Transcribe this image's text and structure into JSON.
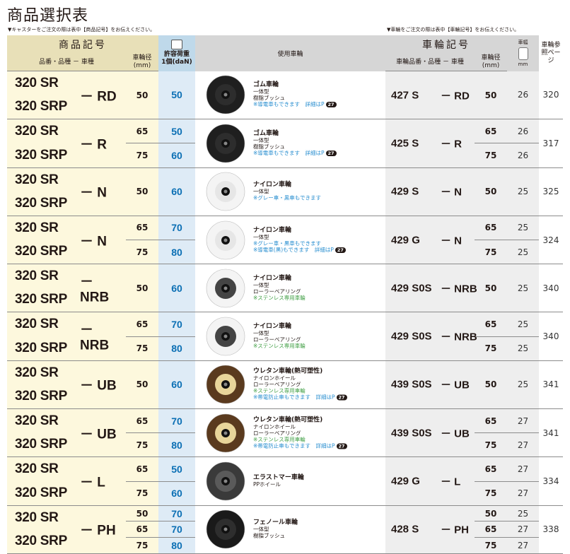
{
  "title": "商品選択表",
  "note_left": "▼キャスターをご注文の際は表中【商品記号】をお伝えください。",
  "note_right": "▼車輪をご注文の際は表中【車輪記号】をお伝えください。",
  "header": {
    "product_code": "商品記号",
    "product_sub": "品番・品種 － 車種",
    "wheel_dia": "車輪径",
    "wheel_dia_unit": "(mm)",
    "load": "許容荷重",
    "load_unit": "1個(daN)",
    "used_wheel": "使用車輪",
    "wheel_code": "車輪記号",
    "wheel_sub": "車輪品番・品種 － 車種",
    "wheel_dia2": "車輪径",
    "wheel_dia2_unit": "(mm)",
    "wheel_width": "車幅",
    "wheel_width_unit": "mm",
    "ref": "車輪参照ページ"
  },
  "rows": [
    {
      "name1": "320 SR",
      "name2": "320 SRP",
      "suffix": "－ RD",
      "dia": [
        "50"
      ],
      "load": [
        "50"
      ],
      "wtitle": "ゴム車輪",
      "wl": [
        [
          "一体型",
          ""
        ],
        [
          "樹脂ブッシュ",
          ""
        ],
        [
          "※導電車もできます　詳細はP",
          "bl"
        ]
      ],
      "badge": "27",
      "wheel_color": "#1f1f1f",
      "hub": "#2d2d2d",
      "wname": "427 S",
      "wsuf": "－ RD",
      "wdia": [
        "50"
      ],
      "wwidth": [
        "26"
      ],
      "ref": "320"
    },
    {
      "name1": "320 SR",
      "name2": "320 SRP",
      "suffix": "－ R",
      "dia": [
        "65",
        "75"
      ],
      "load": [
        "50",
        "60"
      ],
      "wtitle": "ゴム車輪",
      "wl": [
        [
          "一体型",
          ""
        ],
        [
          "樹脂ブッシュ",
          ""
        ],
        [
          "※導電車もできます　詳細はP",
          "bl"
        ]
      ],
      "badge": "27",
      "wheel_color": "#1f1f1f",
      "hub": "#2d2d2d",
      "wname": "425 S",
      "wsuf": "－ R",
      "wdia": [
        "65",
        "75"
      ],
      "wwidth": [
        "26",
        "26"
      ],
      "ref": "317"
    },
    {
      "name1": "320 SR",
      "name2": "320 SRP",
      "suffix": "－ N",
      "dia": [
        "50"
      ],
      "load": [
        "60"
      ],
      "wtitle": "ナイロン車輪",
      "wl": [
        [
          "一体型",
          ""
        ],
        [
          "※グレー車・黒車もできます",
          "bl"
        ]
      ],
      "badge": "",
      "wheel_color": "#f4f4f4",
      "hub": "#e6e6e6",
      "wname": "429 S",
      "wsuf": "－ N",
      "wdia": [
        "50"
      ],
      "wwidth": [
        "25"
      ],
      "ref": "325"
    },
    {
      "name1": "320 SR",
      "name2": "320 SRP",
      "suffix": "－ N",
      "dia": [
        "65",
        "75"
      ],
      "load": [
        "70",
        "80"
      ],
      "wtitle": "ナイロン車輪",
      "wl": [
        [
          "一体型",
          ""
        ],
        [
          "※グレー車・黒車もできます",
          "bl"
        ],
        [
          "※導電車(黒)もできます　詳細はP",
          "bl"
        ]
      ],
      "badge": "27",
      "wheel_color": "#f4f4f4",
      "hub": "#e6e6e6",
      "wname": "429 G",
      "wsuf": "－ N",
      "wdia": [
        "65",
        "75"
      ],
      "wwidth": [
        "25",
        "25"
      ],
      "ref": "324"
    },
    {
      "name1": "320 SR",
      "name2": "320 SRP",
      "suffix": "－ NRB",
      "dia": [
        "50"
      ],
      "load": [
        "60"
      ],
      "wtitle": "ナイロン車輪",
      "wl": [
        [
          "一体型",
          ""
        ],
        [
          "ローラーベアリング",
          ""
        ],
        [
          "※ステンレス専用車輪",
          "gr"
        ]
      ],
      "badge": "",
      "wheel_color": "#f4f4f4",
      "hub": "#444444",
      "wname": "429 S0S",
      "wsuf": "－ NRB",
      "wdia": [
        "50"
      ],
      "wwidth": [
        "25"
      ],
      "ref": "340"
    },
    {
      "name1": "320 SR",
      "name2": "320 SRP",
      "suffix": "－ NRB",
      "dia": [
        "65",
        "75"
      ],
      "load": [
        "70",
        "80"
      ],
      "wtitle": "ナイロン車輪",
      "wl": [
        [
          "一体型",
          ""
        ],
        [
          "ローラーベアリング",
          ""
        ],
        [
          "※ステンレス専用車輪",
          "gr"
        ]
      ],
      "badge": "",
      "wheel_color": "#f4f4f4",
      "hub": "#444444",
      "wname": "429 S0S",
      "wsuf": "－ NRB",
      "wdia": [
        "65",
        "75"
      ],
      "wwidth": [
        "25",
        "25"
      ],
      "ref": "340"
    },
    {
      "name1": "320 SR",
      "name2": "320 SRP",
      "suffix": "－ UB",
      "dia": [
        "50"
      ],
      "load": [
        "60"
      ],
      "wtitle": "ウレタン車輪(熱可塑性)",
      "wl": [
        [
          "ナイロンホイール",
          ""
        ],
        [
          "ローラーベアリング",
          ""
        ],
        [
          "※ステンレス専用車輪",
          "gr"
        ],
        [
          "※帯電防止車もできます　詳細はP",
          "bl"
        ]
      ],
      "badge": "27",
      "wheel_color": "#5a3a1e",
      "hub": "#e8d59a",
      "wname": "439 S0S",
      "wsuf": "－ UB",
      "wdia": [
        "50"
      ],
      "wwidth": [
        "25"
      ],
      "ref": "341"
    },
    {
      "name1": "320 SR",
      "name2": "320 SRP",
      "suffix": "－ UB",
      "dia": [
        "65",
        "75"
      ],
      "load": [
        "70",
        "80"
      ],
      "wtitle": "ウレタン車輪(熱可塑性)",
      "wl": [
        [
          "ナイロンホイール",
          ""
        ],
        [
          "ローラーベアリング",
          ""
        ],
        [
          "※ステンレス専用車輪",
          "gr"
        ],
        [
          "※帯電防止車もできます　詳細はP",
          "bl"
        ]
      ],
      "badge": "27",
      "wheel_color": "#5a3a1e",
      "hub": "#e8d59a",
      "wname": "439 S0S",
      "wsuf": "－ UB",
      "wdia": [
        "65",
        "75"
      ],
      "wwidth": [
        "27",
        "27"
      ],
      "ref": "341"
    },
    {
      "name1": "320 SR",
      "name2": "320 SRP",
      "suffix": "－ L",
      "dia": [
        "65",
        "75"
      ],
      "load": [
        "50",
        "60"
      ],
      "wtitle": "エラストマー車輪",
      "wl": [
        [
          "PPホイール",
          ""
        ]
      ],
      "badge": "",
      "wheel_color": "#3a3a3a",
      "hub": "#5a5a5a",
      "wname": "429 G",
      "wsuf": "－ L",
      "wdia": [
        "65",
        "75"
      ],
      "wwidth": [
        "27",
        "27"
      ],
      "ref": "334"
    },
    {
      "name1": "320 SR",
      "name2": "320 SRP",
      "suffix": "－ PH",
      "dia": [
        "50",
        "65",
        "75"
      ],
      "load": [
        "70",
        "70",
        "80"
      ],
      "wtitle": "フェノール車輪",
      "wl": [
        [
          "一体型",
          ""
        ],
        [
          "樹脂ブッシュ",
          ""
        ]
      ],
      "badge": "",
      "wheel_color": "#1a1a1a",
      "hub": "#2e2e2e",
      "wname": "428 S",
      "wsuf": "－ PH",
      "wdia": [
        "50",
        "65",
        "75"
      ],
      "wwidth": [
        "25",
        "27",
        "27"
      ],
      "ref": "338"
    }
  ],
  "colors": {
    "load_blue": "#0b6fb4",
    "header_tan": "#e8e0b8",
    "header_gray": "#d6d6d6",
    "header_blue": "#bfd9ea",
    "name_bg": "#fdf8dd",
    "load_bg": "#deebf6"
  }
}
